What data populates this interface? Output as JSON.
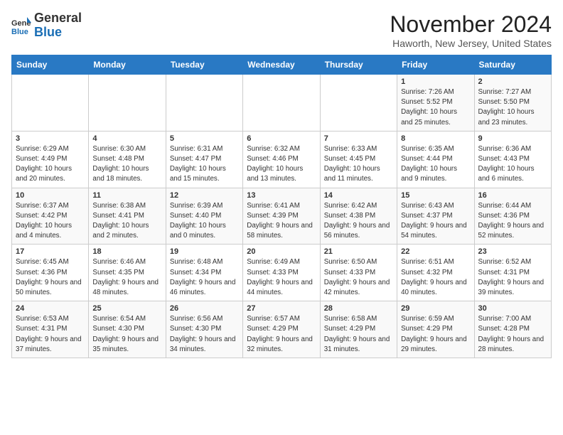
{
  "header": {
    "logo_line1": "General",
    "logo_line2": "Blue",
    "month": "November 2024",
    "location": "Haworth, New Jersey, United States"
  },
  "weekdays": [
    "Sunday",
    "Monday",
    "Tuesday",
    "Wednesday",
    "Thursday",
    "Friday",
    "Saturday"
  ],
  "weeks": [
    [
      {
        "day": "",
        "info": ""
      },
      {
        "day": "",
        "info": ""
      },
      {
        "day": "",
        "info": ""
      },
      {
        "day": "",
        "info": ""
      },
      {
        "day": "",
        "info": ""
      },
      {
        "day": "1",
        "info": "Sunrise: 7:26 AM\nSunset: 5:52 PM\nDaylight: 10 hours and 25 minutes."
      },
      {
        "day": "2",
        "info": "Sunrise: 7:27 AM\nSunset: 5:50 PM\nDaylight: 10 hours and 23 minutes."
      }
    ],
    [
      {
        "day": "3",
        "info": "Sunrise: 6:29 AM\nSunset: 4:49 PM\nDaylight: 10 hours and 20 minutes."
      },
      {
        "day": "4",
        "info": "Sunrise: 6:30 AM\nSunset: 4:48 PM\nDaylight: 10 hours and 18 minutes."
      },
      {
        "day": "5",
        "info": "Sunrise: 6:31 AM\nSunset: 4:47 PM\nDaylight: 10 hours and 15 minutes."
      },
      {
        "day": "6",
        "info": "Sunrise: 6:32 AM\nSunset: 4:46 PM\nDaylight: 10 hours and 13 minutes."
      },
      {
        "day": "7",
        "info": "Sunrise: 6:33 AM\nSunset: 4:45 PM\nDaylight: 10 hours and 11 minutes."
      },
      {
        "day": "8",
        "info": "Sunrise: 6:35 AM\nSunset: 4:44 PM\nDaylight: 10 hours and 9 minutes."
      },
      {
        "day": "9",
        "info": "Sunrise: 6:36 AM\nSunset: 4:43 PM\nDaylight: 10 hours and 6 minutes."
      }
    ],
    [
      {
        "day": "10",
        "info": "Sunrise: 6:37 AM\nSunset: 4:42 PM\nDaylight: 10 hours and 4 minutes."
      },
      {
        "day": "11",
        "info": "Sunrise: 6:38 AM\nSunset: 4:41 PM\nDaylight: 10 hours and 2 minutes."
      },
      {
        "day": "12",
        "info": "Sunrise: 6:39 AM\nSunset: 4:40 PM\nDaylight: 10 hours and 0 minutes."
      },
      {
        "day": "13",
        "info": "Sunrise: 6:41 AM\nSunset: 4:39 PM\nDaylight: 9 hours and 58 minutes."
      },
      {
        "day": "14",
        "info": "Sunrise: 6:42 AM\nSunset: 4:38 PM\nDaylight: 9 hours and 56 minutes."
      },
      {
        "day": "15",
        "info": "Sunrise: 6:43 AM\nSunset: 4:37 PM\nDaylight: 9 hours and 54 minutes."
      },
      {
        "day": "16",
        "info": "Sunrise: 6:44 AM\nSunset: 4:36 PM\nDaylight: 9 hours and 52 minutes."
      }
    ],
    [
      {
        "day": "17",
        "info": "Sunrise: 6:45 AM\nSunset: 4:36 PM\nDaylight: 9 hours and 50 minutes."
      },
      {
        "day": "18",
        "info": "Sunrise: 6:46 AM\nSunset: 4:35 PM\nDaylight: 9 hours and 48 minutes."
      },
      {
        "day": "19",
        "info": "Sunrise: 6:48 AM\nSunset: 4:34 PM\nDaylight: 9 hours and 46 minutes."
      },
      {
        "day": "20",
        "info": "Sunrise: 6:49 AM\nSunset: 4:33 PM\nDaylight: 9 hours and 44 minutes."
      },
      {
        "day": "21",
        "info": "Sunrise: 6:50 AM\nSunset: 4:33 PM\nDaylight: 9 hours and 42 minutes."
      },
      {
        "day": "22",
        "info": "Sunrise: 6:51 AM\nSunset: 4:32 PM\nDaylight: 9 hours and 40 minutes."
      },
      {
        "day": "23",
        "info": "Sunrise: 6:52 AM\nSunset: 4:31 PM\nDaylight: 9 hours and 39 minutes."
      }
    ],
    [
      {
        "day": "24",
        "info": "Sunrise: 6:53 AM\nSunset: 4:31 PM\nDaylight: 9 hours and 37 minutes."
      },
      {
        "day": "25",
        "info": "Sunrise: 6:54 AM\nSunset: 4:30 PM\nDaylight: 9 hours and 35 minutes."
      },
      {
        "day": "26",
        "info": "Sunrise: 6:56 AM\nSunset: 4:30 PM\nDaylight: 9 hours and 34 minutes."
      },
      {
        "day": "27",
        "info": "Sunrise: 6:57 AM\nSunset: 4:29 PM\nDaylight: 9 hours and 32 minutes."
      },
      {
        "day": "28",
        "info": "Sunrise: 6:58 AM\nSunset: 4:29 PM\nDaylight: 9 hours and 31 minutes."
      },
      {
        "day": "29",
        "info": "Sunrise: 6:59 AM\nSunset: 4:29 PM\nDaylight: 9 hours and 29 minutes."
      },
      {
        "day": "30",
        "info": "Sunrise: 7:00 AM\nSunset: 4:28 PM\nDaylight: 9 hours and 28 minutes."
      }
    ]
  ]
}
